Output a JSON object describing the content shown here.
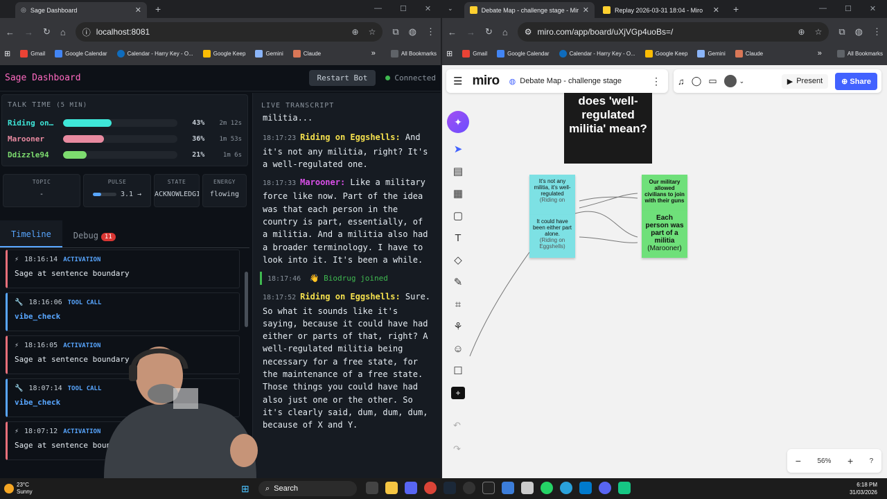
{
  "left_browser": {
    "tab_title": "Sage Dashboard",
    "url": "localhost:8081",
    "bookmarks": [
      "Gmail",
      "Google Calendar",
      "Calendar - Harry Key - O...",
      "Google Keep",
      "Gemini",
      "Claude"
    ],
    "all_bookmarks": "All Bookmarks"
  },
  "sage": {
    "title": "Sage Dashboard",
    "restart_label": "Restart Bot",
    "status": "Connected",
    "talk_time": {
      "heading": "TALK TIME",
      "sub": "(5 MIN)",
      "speakers": [
        {
          "name": "Riding on Eggshells",
          "display": "Riding on…",
          "percent": "43%",
          "fraction": 0.43,
          "time": "2m 12s",
          "color": "#3ee6d8"
        },
        {
          "name": "Marooner",
          "display": "Marooner",
          "percent": "36%",
          "fraction": 0.36,
          "time": "1m 53s",
          "color": "#e88aa0"
        },
        {
          "name": "Ddizzle94",
          "display": "Ddizzle94",
          "percent": "21%",
          "fraction": 0.21,
          "time": "1m 6s",
          "color": "#7ddc6f"
        }
      ]
    },
    "stats": {
      "topic_label": "TOPIC",
      "topic_value": "-",
      "pulse_label": "PULSE",
      "pulse_value": "3.1 →",
      "pulse_fraction": 0.35,
      "state_label": "STATE",
      "state_value": "ACKNOWLEDGING",
      "energy_label": "ENERGY",
      "energy_value": "flowing"
    },
    "tabs": {
      "timeline": "Timeline",
      "debug": "Debug",
      "debug_count": "11"
    },
    "timeline": [
      {
        "time": "18:16:14",
        "kind": "ACTIVATION",
        "text": "Sage at sentence boundary",
        "color": "#e8707a",
        "icon": "⚡"
      },
      {
        "time": "18:16:06",
        "kind": "TOOL CALL",
        "text": "vibe_check",
        "color": "#58a6ff",
        "icon": "🔧"
      },
      {
        "time": "18:16:05",
        "kind": "ACTIVATION",
        "text": "Sage at sentence boundary",
        "color": "#e8707a",
        "icon": "⚡"
      },
      {
        "time": "18:07:14",
        "kind": "TOOL CALL",
        "text": "vibe_check",
        "color": "#58a6ff",
        "icon": "🔧"
      },
      {
        "time": "18:07:12",
        "kind": "ACTIVATION",
        "text": "Sage at sentence boundary",
        "color": "#e8707a",
        "icon": "⚡"
      }
    ],
    "transcript": {
      "heading": "LIVE TRANSCRIPT",
      "lead": "militia...",
      "entries": [
        {
          "time": "18:17:23",
          "speaker": "Riding on Eggshells:",
          "color": "#f4e04d",
          "text": "And it's not any militia, right? It's a well-regulated one."
        },
        {
          "time": "18:17:33",
          "speaker": "Marooner:",
          "color": "#d94fe8",
          "text": "Like a military force like now. Part of the idea was that each person in the country is part, essentially, of a militia. And a militia also had a broader terminology. I have to look into it. It's been a while."
        },
        {
          "time": "18:17:52",
          "speaker": "Riding on Eggshells:",
          "color": "#f4e04d",
          "text": "Sure. So what it sounds like it's saying, because it could have had either or parts of that, right? A well-regulated militia being necessary for a free state, for the maintenance of a free state. Those things you could have had also just one or the other. So it's clearly said, dum, dum, dum, because of X and Y."
        }
      ],
      "join": {
        "time": "18:17:46",
        "icon": "👋",
        "text": "Biodrug joined"
      }
    }
  },
  "right_browser": {
    "tab1": "Debate Map - challenge stage - Miro",
    "tab2": "Replay 2026-03-31 18:04 - Miro",
    "url": "miro.com/app/board/uXjVGp4uoBs=/",
    "bookmarks": [
      "Gmail",
      "Google Calendar",
      "Calendar - Harry Key - O...",
      "Google Keep",
      "Gemini",
      "Claude"
    ],
    "all_bookmarks": "All Bookmarks"
  },
  "miro": {
    "logo": "miro",
    "board_name": "Debate Map - challenge stage",
    "present": "Present",
    "share": "Share",
    "zoom": "56%",
    "question": "does 'well-regulated militia' mean?",
    "stickies": [
      {
        "text": "It's not any militia, it's well-regulated",
        "author": "(Riding on"
      },
      {
        "text": "It could have been either part alone.",
        "author": "(Riding on Eggshells)"
      },
      {
        "text": "Our military allowed civilians to join with their guns",
        "author": ""
      },
      {
        "text": "Each person was part of a militia",
        "author": "(Marooner)"
      }
    ]
  },
  "taskbar": {
    "temp": "23°C",
    "weather": "Sunny",
    "search": "Search",
    "time": "6:18 PM",
    "date": "31/03/2026"
  }
}
